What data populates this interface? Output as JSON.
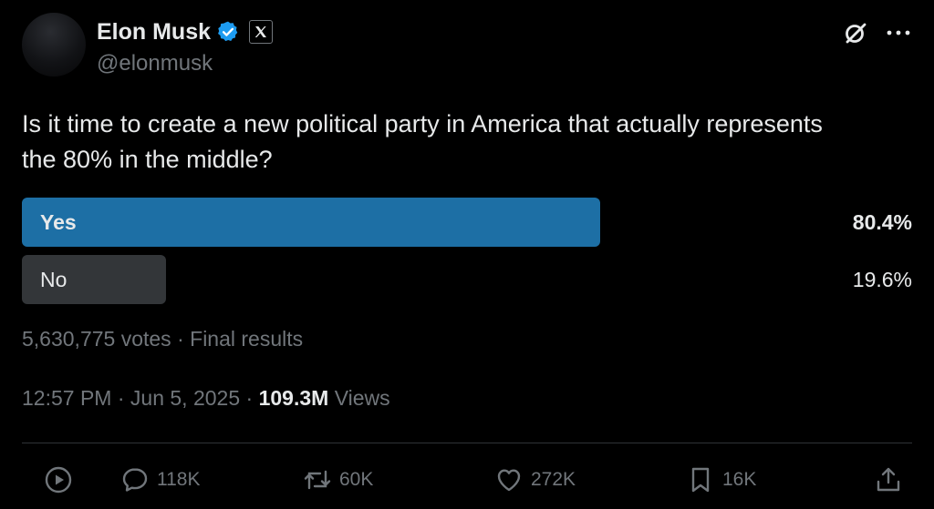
{
  "author": {
    "name": "Elon Musk",
    "handle": "@elonmusk",
    "verified_icon": "verified-badge-icon",
    "affiliate_icon": "x-logo-icon",
    "accent_color": "#1d9bf0"
  },
  "tweet": {
    "text": "Is it time to create a new political party in America that actually represents the 80% in the middle?"
  },
  "poll": {
    "options": [
      {
        "label": "Yes",
        "percent_label": "80.4%",
        "percent": 80.4,
        "winner": true
      },
      {
        "label": "No",
        "percent_label": "19.6%",
        "percent": 19.6,
        "winner": false
      }
    ],
    "votes": "5,630,775 votes",
    "status": "Final results",
    "winner_color": "#1d6fa5",
    "loser_color": "#333639"
  },
  "meta": {
    "time": "12:57 PM",
    "date": "Jun 5, 2025",
    "views_count": "109.3M",
    "views_label": "Views"
  },
  "actions": {
    "replies": "118K",
    "reposts": "60K",
    "likes": "272K",
    "bookmarks": "16K"
  },
  "header_icons": [
    "grok-icon",
    "more-icon"
  ]
}
